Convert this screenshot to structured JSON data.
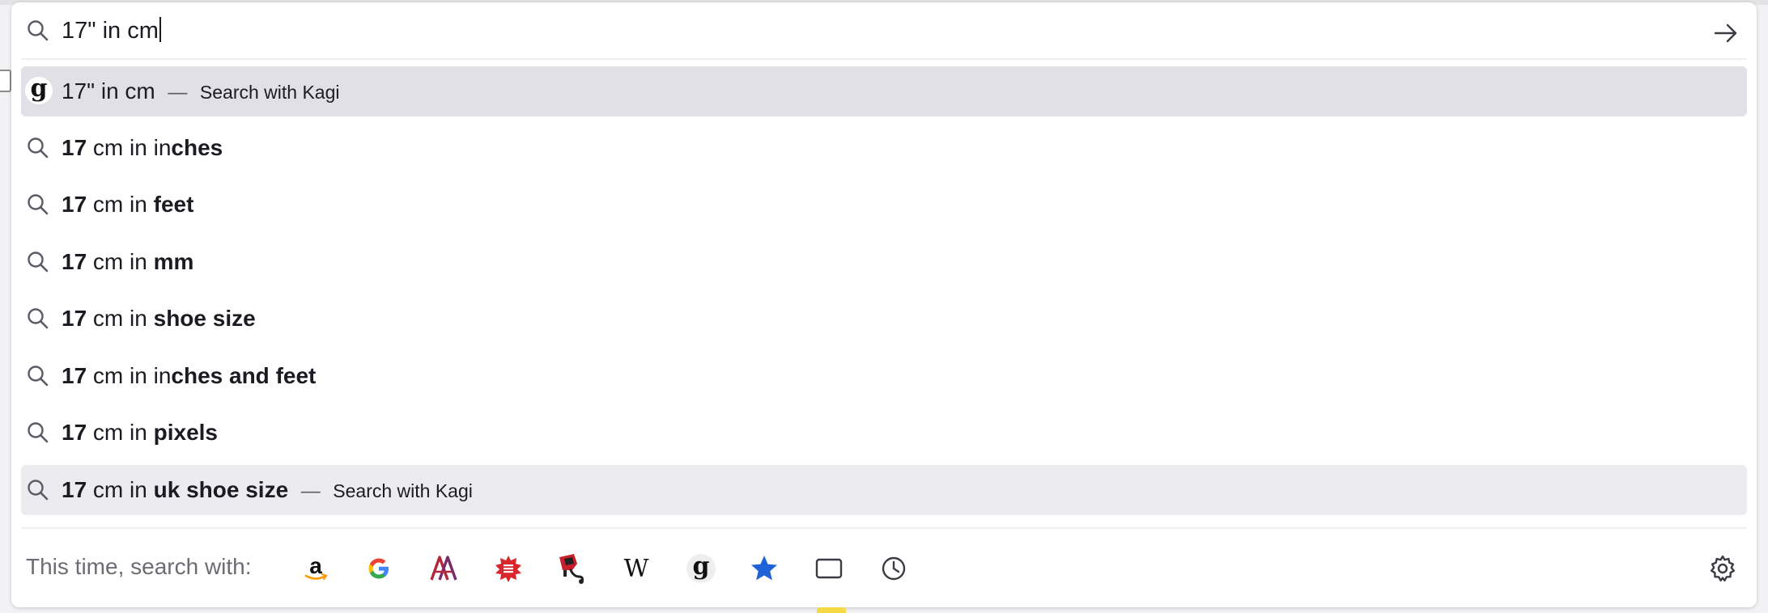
{
  "urlbar": {
    "query": "17\" in cm",
    "go_button": "arrow-right-icon"
  },
  "results": [
    {
      "type": "kagi",
      "prefix": "",
      "query": "17\" in cm",
      "bold": "",
      "separator": "—",
      "action": "Search with Kagi",
      "state": "selected"
    },
    {
      "type": "suggestion",
      "prefix": "17",
      "query": " cm in in",
      "bold": "ches",
      "separator": "",
      "action": "",
      "state": ""
    },
    {
      "type": "suggestion",
      "prefix": "17",
      "query": " cm in ",
      "bold": "feet",
      "separator": "",
      "action": "",
      "state": ""
    },
    {
      "type": "suggestion",
      "prefix": "17",
      "query": " cm in ",
      "bold": "mm",
      "separator": "",
      "action": "",
      "state": ""
    },
    {
      "type": "suggestion",
      "prefix": "17",
      "query": " cm in ",
      "bold": "shoe size",
      "separator": "",
      "action": "",
      "state": ""
    },
    {
      "type": "suggestion",
      "prefix": "17",
      "query": " cm in in",
      "bold": "ches and feet",
      "separator": "",
      "action": "",
      "state": ""
    },
    {
      "type": "suggestion",
      "prefix": "17",
      "query": " cm in ",
      "bold": "pixels",
      "separator": "",
      "action": "",
      "state": ""
    },
    {
      "type": "suggestion",
      "prefix": "17",
      "query": " cm in ",
      "bold": "uk shoe size",
      "separator": "—",
      "action": "Search with Kagi",
      "state": "hover"
    }
  ],
  "footer": {
    "label": "This time, search with:",
    "engines": [
      "amazon-icon",
      "google-icon",
      "arch-wiki-icon",
      "red-engine-icon",
      "red-mascot-icon",
      "wikipedia-icon",
      "kagi-icon",
      "bookmarks-star-icon",
      "tabs-icon",
      "history-clock-icon"
    ],
    "settings_icon": "gear-icon"
  },
  "colors": {
    "selected_row": "#e0e0e6",
    "hover_row": "#ececf0",
    "star_blue": "#1f63d6"
  }
}
